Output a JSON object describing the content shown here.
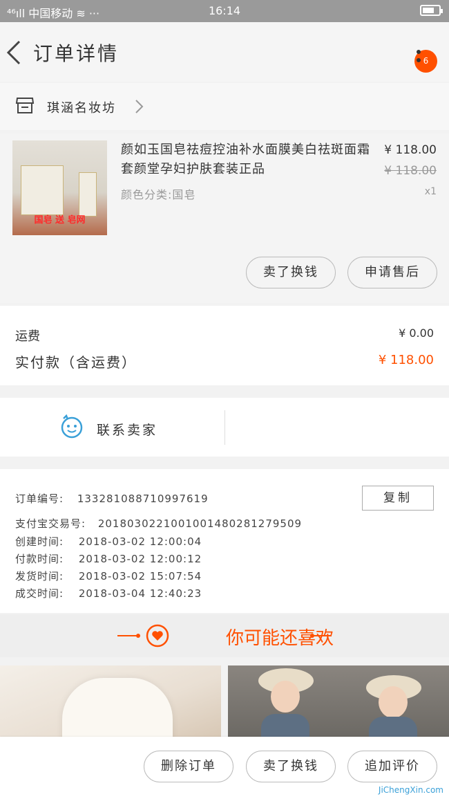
{
  "status_bar": {
    "left": "⁴⁶ıll 中国移动 ≋ ···",
    "time": "16:14"
  },
  "header": {
    "title": "订单详情",
    "badge": "6"
  },
  "shop": {
    "name": "琪涵名妆坊"
  },
  "product": {
    "thumb_text": "国皂 送 皂网",
    "name": "颜如玉国皂祛痘控油补水面膜美白祛斑面霜套颜堂孕妇护肤套装正品",
    "spec": "颜色分类:国皂",
    "price": "¥ 118.00",
    "original_price": "¥ 118.00",
    "quantity": "x1",
    "buttons": {
      "resell": "卖了换钱",
      "after_sale": "申请售后"
    }
  },
  "payment": {
    "shipping_label": "运费",
    "shipping_value": "¥ 0.00",
    "paid_label": "实付款（含运费）",
    "paid_value": "¥ 118.00"
  },
  "contact": {
    "label": "联系卖家"
  },
  "order_info": {
    "order_no_label": "订单编号:",
    "order_no": "133281088710997619",
    "copy": "复制",
    "alipay_label": "支付宝交易号:",
    "alipay_no": "2018030221001001480281279509",
    "created_label": "创建时间:",
    "created": "2018-03-02 12:00:04",
    "paid_label": "付款时间:",
    "paid": "2018-03-02 12:00:12",
    "shipped_label": "发货时间:",
    "shipped": "2018-03-02 15:07:54",
    "done_label": "成交时间:",
    "done": "2018-03-04 12:40:23"
  },
  "guess": {
    "title": "你可能还喜欢"
  },
  "bottom_bar": {
    "delete": "删除订单",
    "resell": "卖了换钱",
    "review": "追加评价"
  },
  "watermark": "JiChengXin.com",
  "colors": {
    "accent": "#ff5000",
    "status_bar": "#9a9a9a",
    "contact_icon": "#3aa0d8"
  }
}
